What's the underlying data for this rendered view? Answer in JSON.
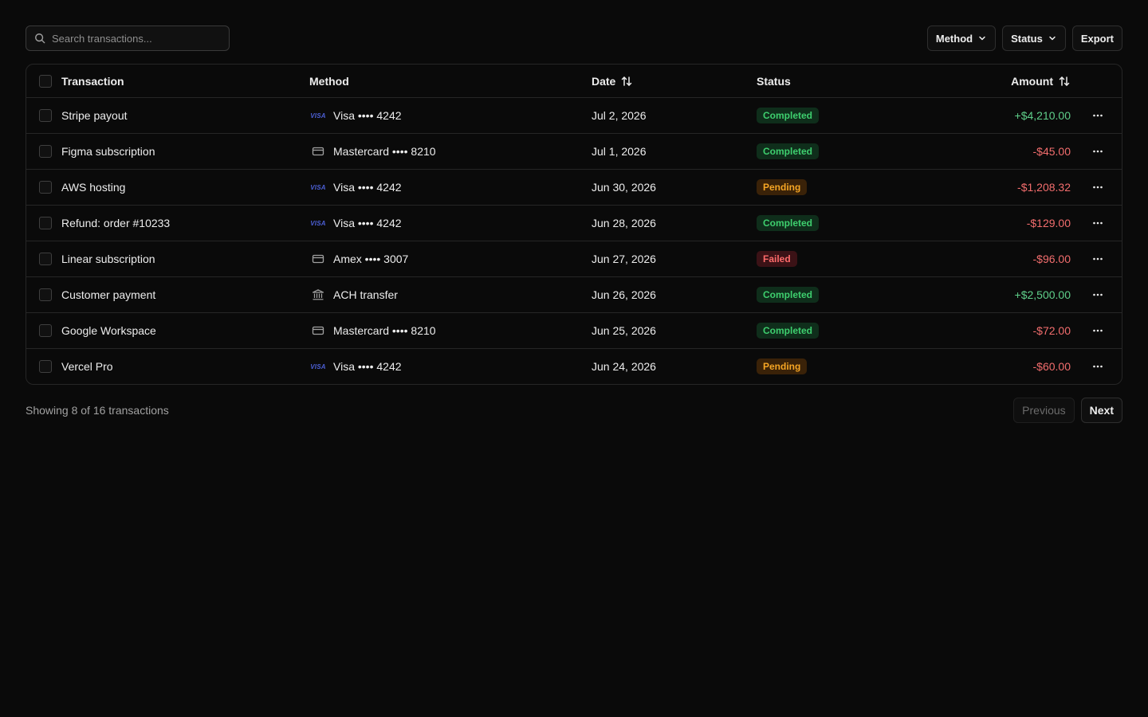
{
  "search": {
    "placeholder": "Search transactions..."
  },
  "filters": {
    "method_label": "Method",
    "status_label": "Status",
    "export_label": "Export"
  },
  "table": {
    "columns": {
      "transaction": "Transaction",
      "method": "Method",
      "date": "Date",
      "status": "Status",
      "amount": "Amount"
    },
    "rows": [
      {
        "name": "Stripe payout",
        "method_icon": "visa-icon",
        "method_badge": "VISA",
        "method": "Visa •••• 4242",
        "date": "Jul 2, 2026",
        "status": "Completed",
        "status_kind": "completed",
        "amount": "+$4,210.00",
        "sign": "pos"
      },
      {
        "name": "Figma subscription",
        "method_icon": "credit-card-icon",
        "method_badge": "",
        "method": "Mastercard •••• 8210",
        "date": "Jul 1, 2026",
        "status": "Completed",
        "status_kind": "completed",
        "amount": "-$45.00",
        "sign": "neg"
      },
      {
        "name": "AWS hosting",
        "method_icon": "visa-icon",
        "method_badge": "VISA",
        "method": "Visa •••• 4242",
        "date": "Jun 30, 2026",
        "status": "Pending",
        "status_kind": "pending",
        "amount": "-$1,208.32",
        "sign": "neg"
      },
      {
        "name": "Refund: order #10233",
        "method_icon": "visa-icon",
        "method_badge": "VISA",
        "method": "Visa •••• 4242",
        "date": "Jun 28, 2026",
        "status": "Completed",
        "status_kind": "completed",
        "amount": "-$129.00",
        "sign": "neg"
      },
      {
        "name": "Linear subscription",
        "method_icon": "credit-card-icon",
        "method_badge": "",
        "method": "Amex •••• 3007",
        "date": "Jun 27, 2026",
        "status": "Failed",
        "status_kind": "failed",
        "amount": "-$96.00",
        "sign": "neg"
      },
      {
        "name": "Customer payment",
        "method_icon": "bank-icon",
        "method_badge": "",
        "method": "ACH transfer",
        "date": "Jun 26, 2026",
        "status": "Completed",
        "status_kind": "completed",
        "amount": "+$2,500.00",
        "sign": "pos"
      },
      {
        "name": "Google Workspace",
        "method_icon": "credit-card-icon",
        "method_badge": "",
        "method": "Mastercard •••• 8210",
        "date": "Jun 25, 2026",
        "status": "Completed",
        "status_kind": "completed",
        "amount": "-$72.00",
        "sign": "neg"
      },
      {
        "name": "Vercel Pro",
        "method_icon": "visa-icon",
        "method_badge": "VISA",
        "method": "Visa •••• 4242",
        "date": "Jun 24, 2026",
        "status": "Pending",
        "status_kind": "pending",
        "amount": "-$60.00",
        "sign": "neg"
      }
    ]
  },
  "footer": {
    "info": "Showing 8 of 16 transactions",
    "previous_label": "Previous",
    "next_label": "Next"
  },
  "colors": {
    "background": "#0a0a0a",
    "completed": "#3ecf6e",
    "pending": "#f5a524",
    "failed": "#ff6b6b",
    "positive_amount": "#5fcf8a",
    "negative_amount": "#f26d6d",
    "visa_blue": "#4c5fd5"
  }
}
